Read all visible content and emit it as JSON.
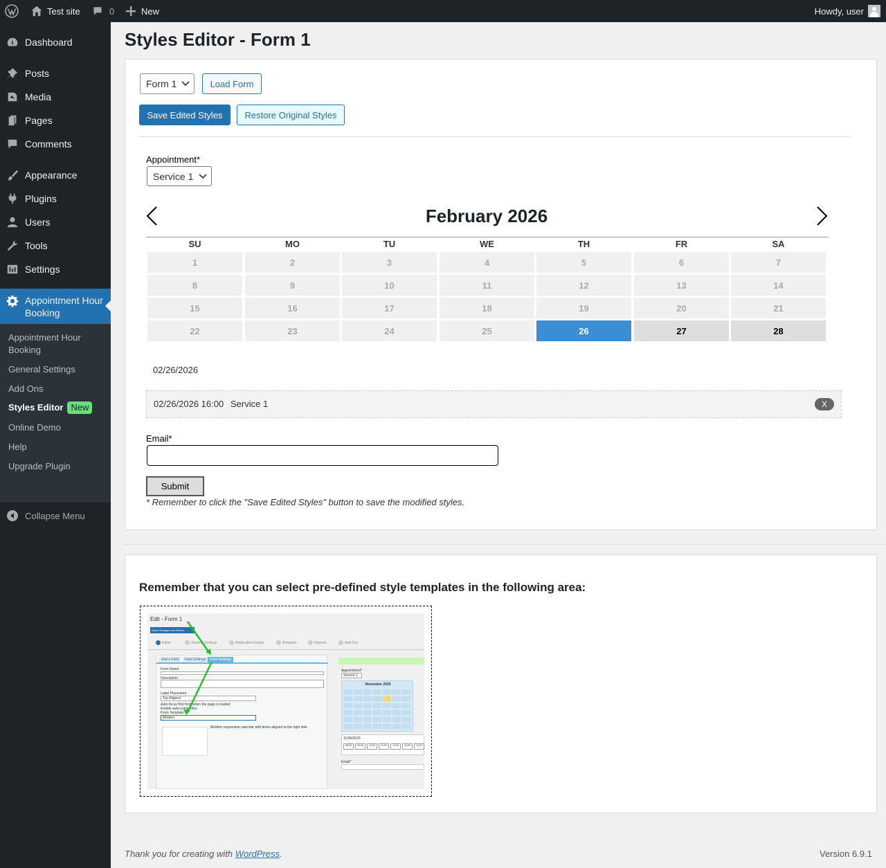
{
  "adminbar": {
    "site_name": "Test site",
    "comments_count": "0",
    "new_label": "New",
    "howdy": "Howdy, user"
  },
  "sidebar": {
    "items": [
      {
        "label": "Dashboard",
        "icon": "dashboard-icon"
      },
      {
        "label": "Posts",
        "icon": "pin-icon"
      },
      {
        "label": "Media",
        "icon": "media-icon"
      },
      {
        "label": "Pages",
        "icon": "pages-icon"
      },
      {
        "label": "Comments",
        "icon": "comment-icon"
      },
      {
        "label": "Appearance",
        "icon": "brush-icon"
      },
      {
        "label": "Plugins",
        "icon": "plug-icon"
      },
      {
        "label": "Users",
        "icon": "user-icon"
      },
      {
        "label": "Tools",
        "icon": "wrench-icon"
      },
      {
        "label": "Settings",
        "icon": "settings-icon"
      }
    ],
    "current": {
      "label_line1": "Appointment Hour",
      "label_line2": "Booking",
      "icon": "gear-icon"
    },
    "submenu": [
      {
        "label_line1": "Appointment Hour",
        "label_line2": "Booking"
      },
      {
        "label": "General Settings"
      },
      {
        "label": "Add Ons"
      },
      {
        "label": "Styles Editor",
        "badge": "New"
      },
      {
        "label": "Online Demo"
      },
      {
        "label": "Help"
      },
      {
        "label": "Upgrade Plugin"
      }
    ],
    "collapse_label": "Collapse Menu"
  },
  "page": {
    "title": "Styles Editor - Form 1"
  },
  "editor": {
    "form_select": "Form 1",
    "load_form": "Load Form",
    "save_styles": "Save Edited Styles",
    "restore_styles": "Restore Original Styles"
  },
  "form": {
    "appointment_label": "Appointment*",
    "service_select": "Service 1",
    "calendar": {
      "month_title": "February 2026",
      "weekdays": [
        "SU",
        "MO",
        "TU",
        "WE",
        "TH",
        "FR",
        "SA"
      ],
      "days": [
        [
          "1",
          "2",
          "3",
          "4",
          "5",
          "6",
          "7"
        ],
        [
          "8",
          "9",
          "10",
          "11",
          "12",
          "13",
          "14"
        ],
        [
          "15",
          "16",
          "17",
          "18",
          "19",
          "20",
          "21"
        ],
        [
          "22",
          "23",
          "24",
          "25",
          "26",
          "27",
          "28"
        ]
      ],
      "selected_day": "26",
      "available_days": [
        "27",
        "28"
      ],
      "selected_color": "#3a8fd4"
    },
    "selected_date": "02/26/2026",
    "slot": {
      "datetime": "02/26/2026 16:00",
      "service": "Service 1",
      "remove": "X"
    },
    "email_label": "Email*",
    "email_value": "",
    "submit": "Submit",
    "note": "* Remember to click the \"Save Edited Styles\" button to save the modified styles."
  },
  "templates": {
    "heading": "Remember that you can select pre-defined style templates in the following area:",
    "screenshot": {
      "title": "Edit - Form 1",
      "save_btn": "Save Changes and Return",
      "steps": [
        "Editor",
        "General Settings",
        "Notification Emails",
        "Antispam",
        "Reports",
        "Add Ons"
      ],
      "tabs": [
        "Add a Field",
        "Field Settings",
        "Form Settings"
      ],
      "fields": [
        "Form Name",
        "Description",
        "Label Placement",
        "Form Template"
      ],
      "label_placement_value": "Top Aligned",
      "template_value": "Modern",
      "checkbox1": "Auto-focus first form when the page is loaded",
      "checkbox2": "Enable auto-completion",
      "template_desc": "Modern responsive calendar with times aligned to the right side",
      "mini_cal_title": "November 2025",
      "mini_appointment": "Appointment*",
      "mini_service": "Service 1",
      "mini_date": "11/06/2025",
      "mini_times": [
        "08:00",
        "09:00",
        "10:00",
        "11:00",
        "12:00",
        "13:00",
        "14:00"
      ],
      "mini_email": "Email*",
      "arrow_color": "#22c322"
    }
  },
  "footer": {
    "thanks_prefix": "Thank you for creating with ",
    "wp_link": "WordPress",
    "thanks_suffix": ".",
    "version": "Version 6.9.1"
  }
}
